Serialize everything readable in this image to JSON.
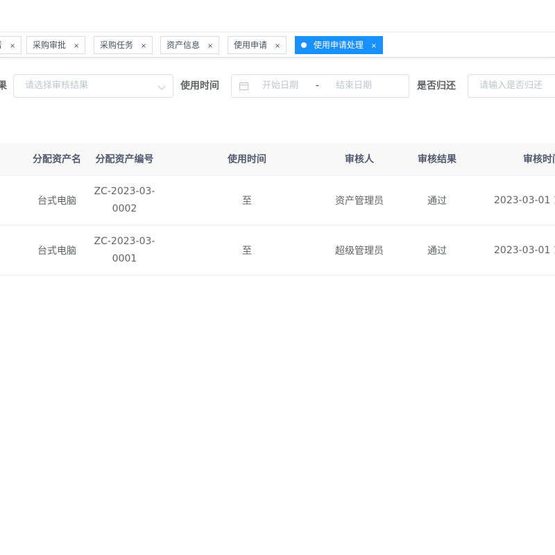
{
  "tags": [
    {
      "label": "者",
      "close": "×"
    },
    {
      "label": "采购审批",
      "close": "×"
    },
    {
      "label": "采购任务",
      "close": "×"
    },
    {
      "label": "资产信息",
      "close": "×"
    },
    {
      "label": "使用申请",
      "close": "×"
    },
    {
      "label": "使用申请处理",
      "close": "×",
      "active": true
    }
  ],
  "form": {
    "result_label": "果",
    "result_placeholder": "请选择审核结果",
    "time_label": "使用时间",
    "time_start_placeholder": "开始日期",
    "time_separator": "-",
    "time_end_placeholder": "结束日期",
    "return_label": "是否归还",
    "return_placeholder": "请输入是否归还"
  },
  "table": {
    "headers": {
      "asset_name": "分配资产名",
      "asset_code": "分配资产编号",
      "use_time": "使用时间",
      "auditor": "审核人",
      "result": "审核结果",
      "audit_time": "审核时间"
    },
    "rows": [
      {
        "asset_name": "台式电脑",
        "asset_code": "ZC-2023-03-0002",
        "use_time": "至",
        "auditor": "资产管理员",
        "result": "通过",
        "audit_time": "2023-03-01 1"
      },
      {
        "asset_name": "台式电脑",
        "asset_code": "ZC-2023-03-0001",
        "use_time": "至",
        "auditor": "超级管理员",
        "result": "通过",
        "audit_time": "2023-03-01 1"
      }
    ]
  },
  "colors": {
    "accent": "#1890ff",
    "header_bg": "#f8f8f9",
    "border": "#dcdfe6"
  }
}
